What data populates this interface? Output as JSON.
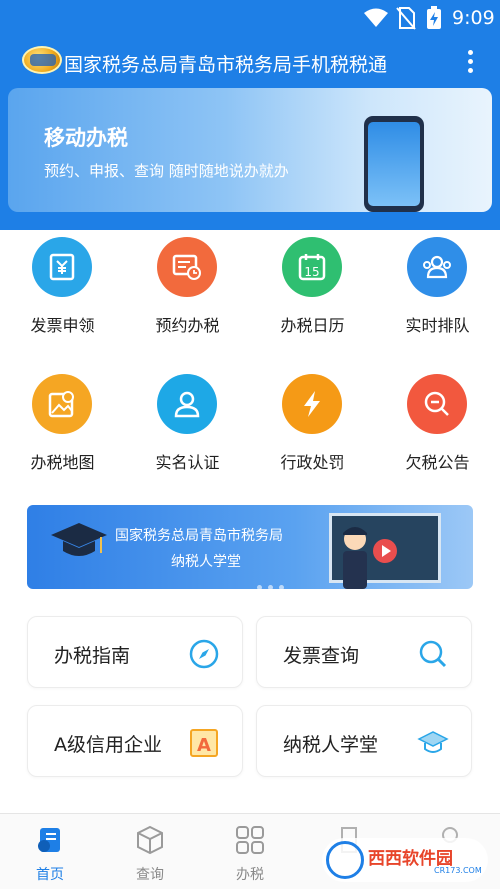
{
  "status_bar": {
    "time": "9:09"
  },
  "app": {
    "title": "国家税务总局青岛市税务局手机税税通"
  },
  "banner": {
    "title": "移动办税",
    "subtitle": "预约、申报、查询 随时随地说办就办"
  },
  "grid": [
    {
      "label": "发票申领",
      "icon": "invoice-icon",
      "color": "#2aa6e8"
    },
    {
      "label": "预约办税",
      "icon": "appointment-icon",
      "color": "#f26a3d"
    },
    {
      "label": "办税日历",
      "icon": "calendar-icon",
      "color": "#2fbf71",
      "day": "15"
    },
    {
      "label": "实时排队",
      "icon": "queue-icon",
      "color": "#2f8ee8"
    },
    {
      "label": "办税地图",
      "icon": "map-icon",
      "color": "#f5a623"
    },
    {
      "label": "实名认证",
      "icon": "user-icon",
      "color": "#1ea8e6"
    },
    {
      "label": "行政处罚",
      "icon": "lightning-icon",
      "color": "#f59a16"
    },
    {
      "label": "欠税公告",
      "icon": "search-minus-icon",
      "color": "#f2583e"
    }
  ],
  "school_banner": {
    "line1": "国家税务总局青岛市税务局",
    "line2": "纳税人学堂"
  },
  "cards": [
    {
      "label": "办税指南",
      "icon": "compass-icon"
    },
    {
      "label": "发票查询",
      "icon": "search-icon"
    },
    {
      "label": "A级信用企业",
      "icon": "grade-a-icon"
    },
    {
      "label": "纳税人学堂",
      "icon": "graduation-cap-icon"
    }
  ],
  "bottom_nav": [
    {
      "label": "首页",
      "icon": "home-icon",
      "active": true
    },
    {
      "label": "查询",
      "icon": "cube-icon"
    },
    {
      "label": "办税",
      "icon": "apps-icon"
    }
  ],
  "watermark": {
    "text": "西西软件园",
    "sub": "CR173.COM"
  },
  "colors": {
    "primary": "#1e7fe6"
  }
}
